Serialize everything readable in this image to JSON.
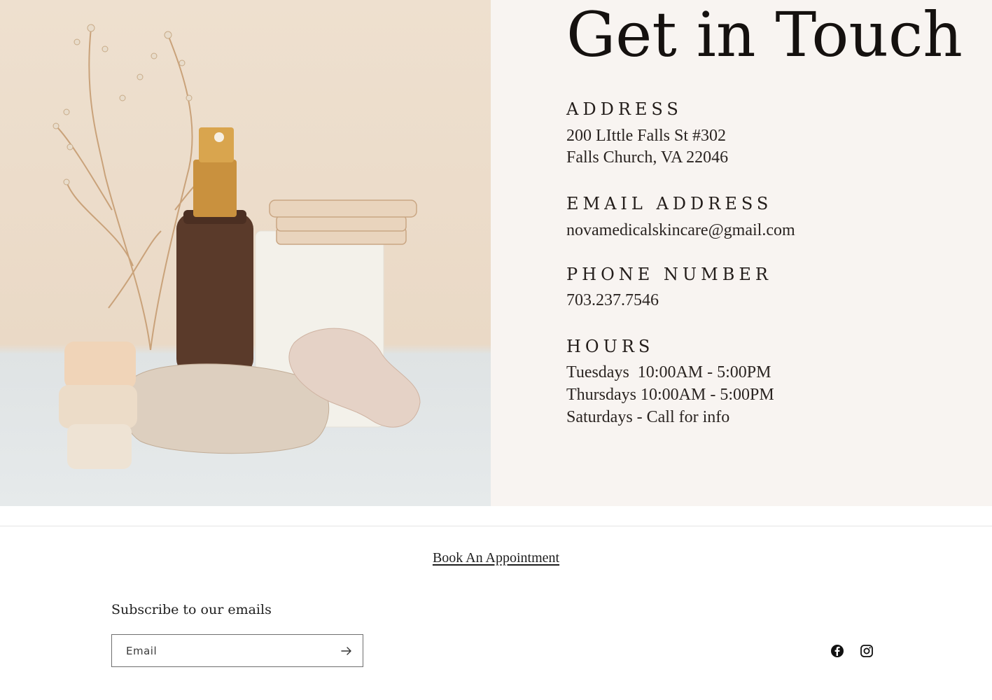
{
  "hero": {
    "title": "Get in Touch",
    "address_label": "ADDRESS",
    "address_line1": "200 LIttle Falls St #302",
    "address_line2": "Falls Church, VA 22046",
    "email_label": "EMAIL ADDRESS",
    "email_value": "novamedicalskincare@gmail.com",
    "phone_label": "PHONE NUMBER",
    "phone_value": "703.237.7546",
    "hours_label": "HOURS",
    "hours": [
      "Tuesdays  10:00AM - 5:00PM",
      "Thursdays 10:00AM - 5:00PM",
      "Saturdays - Call for info"
    ]
  },
  "footer": {
    "book_link": "Book An Appointment",
    "subscribe_heading": "Subscribe to our emails",
    "email_placeholder": "Email",
    "social_icons": [
      "facebook-icon",
      "instagram-icon"
    ]
  },
  "colors": {
    "panel_background": "#f8f4f1",
    "text_dark": "#15110f",
    "divider": "#e4e4e4"
  }
}
